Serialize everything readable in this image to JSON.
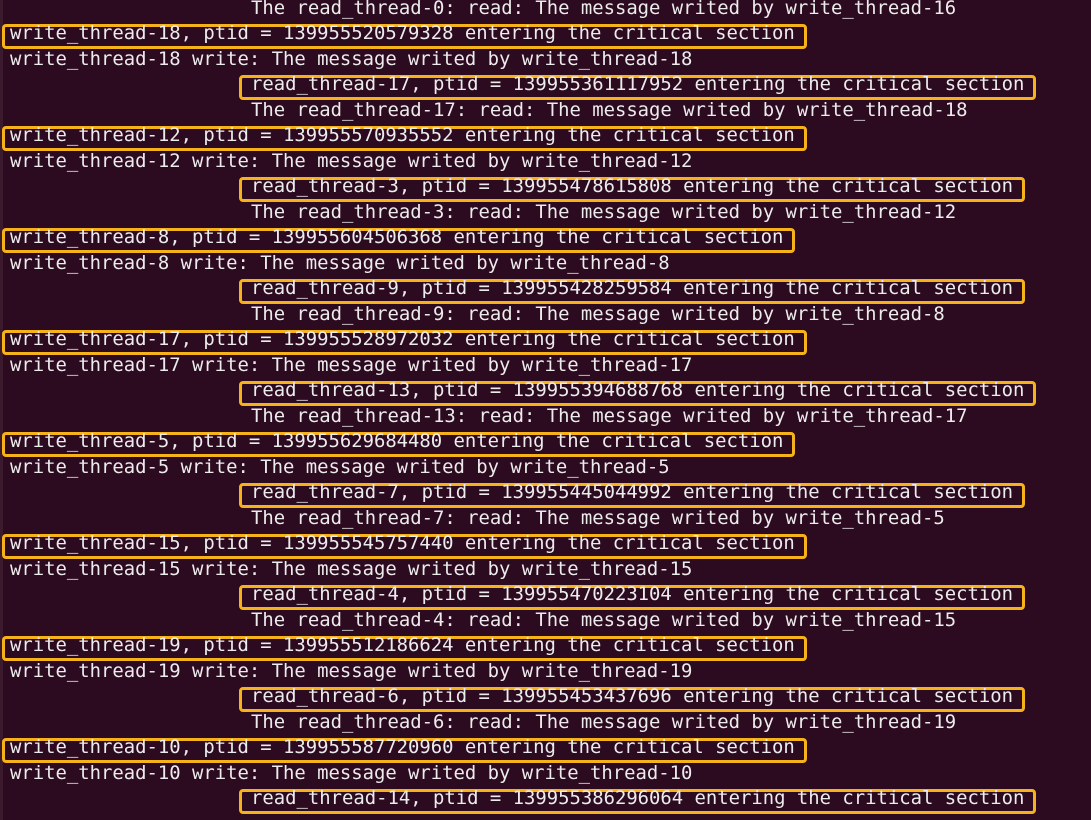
{
  "accent": "#f5b21b",
  "background": "#2c0a1f",
  "text_color": "#ececec",
  "lines": [
    {
      "text": "The read_thread-0: read: The message writed by write_thread-16",
      "indent": true,
      "highlighted": false
    },
    {
      "text": "write_thread-18, ptid = 139955520579328 entering the critical section",
      "indent": false,
      "highlighted": true
    },
    {
      "text": "write_thread-18 write: The message writed by write_thread-18",
      "indent": false,
      "highlighted": false
    },
    {
      "text": "read_thread-17, ptid = 139955361117952 entering the critical section",
      "indent": true,
      "highlighted": true
    },
    {
      "text": "The read_thread-17: read: The message writed by write_thread-18",
      "indent": true,
      "highlighted": false
    },
    {
      "text": "write_thread-12, ptid = 139955570935552 entering the critical section",
      "indent": false,
      "highlighted": true
    },
    {
      "text": "write_thread-12 write: The message writed by write_thread-12",
      "indent": false,
      "highlighted": false
    },
    {
      "text": "read_thread-3, ptid = 139955478615808 entering the critical section",
      "indent": true,
      "highlighted": true
    },
    {
      "text": "The read_thread-3: read: The message writed by write_thread-12",
      "indent": true,
      "highlighted": false
    },
    {
      "text": "write_thread-8, ptid = 139955604506368 entering the critical section",
      "indent": false,
      "highlighted": true
    },
    {
      "text": "write_thread-8 write: The message writed by write_thread-8",
      "indent": false,
      "highlighted": false
    },
    {
      "text": "read_thread-9, ptid = 139955428259584 entering the critical section",
      "indent": true,
      "highlighted": true
    },
    {
      "text": "The read_thread-9: read: The message writed by write_thread-8",
      "indent": true,
      "highlighted": false
    },
    {
      "text": "write_thread-17, ptid = 139955528972032 entering the critical section",
      "indent": false,
      "highlighted": true
    },
    {
      "text": "write_thread-17 write: The message writed by write_thread-17",
      "indent": false,
      "highlighted": false
    },
    {
      "text": "read_thread-13, ptid = 139955394688768 entering the critical section",
      "indent": true,
      "highlighted": true
    },
    {
      "text": "The read_thread-13: read: The message writed by write_thread-17",
      "indent": true,
      "highlighted": false
    },
    {
      "text": "write_thread-5, ptid = 139955629684480 entering the critical section",
      "indent": false,
      "highlighted": true
    },
    {
      "text": "write_thread-5 write: The message writed by write_thread-5",
      "indent": false,
      "highlighted": false
    },
    {
      "text": "read_thread-7, ptid = 139955445044992 entering the critical section",
      "indent": true,
      "highlighted": true
    },
    {
      "text": "The read_thread-7: read: The message writed by write_thread-5",
      "indent": true,
      "highlighted": false
    },
    {
      "text": "write_thread-15, ptid = 139955545757440 entering the critical section",
      "indent": false,
      "highlighted": true
    },
    {
      "text": "write_thread-15 write: The message writed by write_thread-15",
      "indent": false,
      "highlighted": false
    },
    {
      "text": "read_thread-4, ptid = 139955470223104 entering the critical section",
      "indent": true,
      "highlighted": true
    },
    {
      "text": "The read_thread-4: read: The message writed by write_thread-15",
      "indent": true,
      "highlighted": false
    },
    {
      "text": "write_thread-19, ptid = 139955512186624 entering the critical section",
      "indent": false,
      "highlighted": true
    },
    {
      "text": "write_thread-19 write: The message writed by write_thread-19",
      "indent": false,
      "highlighted": false
    },
    {
      "text": "read_thread-6, ptid = 139955453437696 entering the critical section",
      "indent": true,
      "highlighted": true
    },
    {
      "text": "The read_thread-6: read: The message writed by write_thread-19",
      "indent": true,
      "highlighted": false
    },
    {
      "text": "write_thread-10, ptid = 139955587720960 entering the critical section",
      "indent": false,
      "highlighted": true
    },
    {
      "text": "write_thread-10 write: The message writed by write_thread-10",
      "indent": false,
      "highlighted": false
    },
    {
      "text": "read_thread-14, ptid = 139955386296064 entering the critical section",
      "indent": true,
      "highlighted": true
    }
  ]
}
